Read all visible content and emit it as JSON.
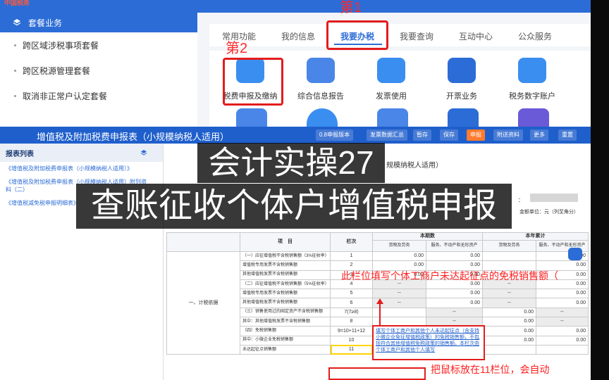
{
  "portal": {
    "logo_text": "中国税务",
    "sidebar_title": "套餐业务",
    "sidebar_items": [
      "跨区域涉税事项套餐",
      "跨区税源管理套餐",
      "取消非正常户认定套餐"
    ],
    "nav_tabs": [
      "常用功能",
      "我的信息",
      "我要办税",
      "我要查询",
      "互动中心",
      "公众服务"
    ],
    "active_tab": "我要办税",
    "services": [
      "税费申报及缴纳",
      "综合信息报告",
      "发票使用",
      "开票业务",
      "税务数字账户"
    ],
    "service_colors": [
      "#3a8ef0",
      "#4a86e8",
      "#3a8ef0",
      "#2c6cd6",
      "#3a8ef0"
    ],
    "step1_label": "第1",
    "step2_label": "第2"
  },
  "declaration": {
    "title": "增值税及附加税费申报表（小规模纳税人适用）",
    "toolbar": [
      "0.8申报版本",
      "发票数据汇总",
      "暂存",
      "保存",
      "申报",
      "附送资料",
      "更多",
      "重置"
    ],
    "report_list_title": "报表列表",
    "report_list": [
      "《增值税及附加税费申报表（小规模纳税人适用）》",
      "《增值税及附加税费申报表（小规模纳税人适用）附列资料（二）",
      "《增值税减免税申报明细表》"
    ],
    "form_subtitle": "规模纳税人适用）",
    "unit_text": "金额单位：元（列至角分）",
    "colon": "："
  },
  "table": {
    "header_item": "项　目",
    "header_col": "栏次",
    "header_this_period": "本期数",
    "header_ytd": "本年累计",
    "sub_goods": "货物及劳务",
    "sub_service": "服务、不动产和无形资产",
    "category": "一、计税依据",
    "rows": [
      {
        "item": "（一）应征增值税不含税销售额（3%征收率）",
        "line": "1",
        "v": [
          "0.00",
          "0.00",
          "",
          "0.00"
        ]
      },
      {
        "item": "增值税专用发票不含税销售额",
        "line": "2",
        "v": [
          "0.00",
          "0.00",
          "",
          "0.00"
        ]
      },
      {
        "item": "其他增值税发票不含税销售额",
        "line": "3",
        "v": [
          "0.00",
          "0.00",
          "",
          "0.00"
        ]
      },
      {
        "item": "（二）应征增值税不含税销售额（5%征收率）",
        "line": "4",
        "v": [
          "--",
          "0.00",
          "--",
          "0.00"
        ]
      },
      {
        "item": "增值税专用发票不含税销售额",
        "line": "5",
        "v": [
          "--",
          "0.00",
          "--",
          "0.00"
        ]
      },
      {
        "item": "其他增值税发票不含税销售额",
        "line": "6",
        "v": [
          "--",
          "0.00",
          "--",
          "0.00"
        ]
      },
      {
        "item": "（三）销售使用过的固定资产不含税销售额",
        "line": "7(7≥8)",
        "v": [
          "",
          "--",
          "0.00",
          "--"
        ]
      },
      {
        "item": "其中：其他增值税发票不含税销售额",
        "line": "8",
        "v": [
          "",
          "--",
          "0.00",
          "--"
        ]
      },
      {
        "item": "（四）免税销售额",
        "line": "9=10+11+12",
        "v": [
          "",
          "",
          "0.00",
          "0.00"
        ]
      },
      {
        "item": "其中：小微企业免税销售额",
        "line": "10",
        "v": [
          "0.00",
          "0.00",
          "0.00",
          "0.00"
        ]
      },
      {
        "item": "未达起征点销售额",
        "line": "11",
        "v": [
          "",
          "",
          "",
          ""
        ]
      }
    ]
  },
  "overlays": {
    "title1": "会计实操27",
    "title2": "查账征收个体户增值税申报",
    "note_red": "此栏位填写个体工商户未达起征点的免税销售额（",
    "note_box": "填写个体工商户和其他个人未达起征点（含支持小微企业免征增值税政策）的免税销售额，不包括符合其他增值税免税政策的销售额。本栏次由个体工商户和其他个人填写",
    "note_bottom": "把鼠标放在11栏位，会自动"
  }
}
